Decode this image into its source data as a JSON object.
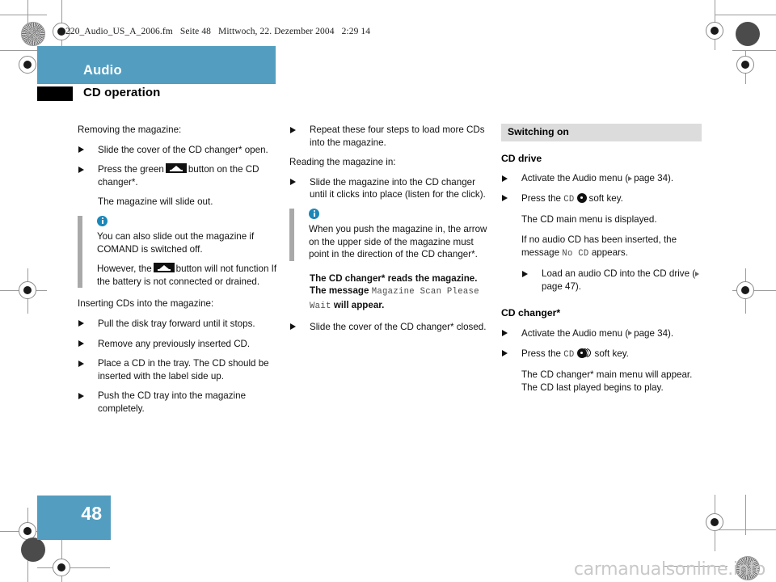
{
  "page": {
    "file_line": [
      "220_Audio_US_A_2006.fm",
      "Seite 48",
      "Mittwoch, 22. Dezember 2004",
      "2:29 14"
    ],
    "chapter_title": "Audio",
    "section_title": "CD operation",
    "page_number": "48",
    "watermark": "carmanualsonline.info",
    "brand_color": "#539ec0",
    "grey_head_color": "#dcdcdc",
    "info_icon_color": "#1a87b8"
  },
  "column1": {
    "intro": "Removing the magazine:",
    "b1": "Slide the cover of the CD changer* open.",
    "b2_pre": "Press the green",
    "b2_post": "button on the CD changer*.",
    "b2_result": "The magazine will slide out.",
    "note1_p1": "You can also slide out the magazine if COMAND is switched off.",
    "note1_p2_pre": "However, the",
    "note1_p2_post": "button will not function If the battery is not connected or drained.",
    "intro2": "Inserting CDs into the magazine:",
    "b3": "Pull the disk tray forward until it stops.",
    "b4": "Remove any previously inserted CD.",
    "b5": "Place a CD in the tray. The CD should be inserted with the label side up.",
    "b6": "Push the CD tray into the magazine completely."
  },
  "column2": {
    "b1": "Repeat these four steps to load more CDs into the magazine.",
    "intro": "Reading the magazine in:",
    "b2": "Slide the magazine into the CD changer until it clicks into place (listen for the click).",
    "note_p1": "When you push the magazine in, the arrow on the upper side of the magazine must point in the direction of the CD changer*.",
    "result_bold_1": "The CD changer* reads the magazine.",
    "result_bold_2": "The message",
    "result_mono": "Magazine Scan Please Wait",
    "result_bold_3": "will appear.",
    "b3": "Slide the cover of the CD changer* closed."
  },
  "column3": {
    "section_head": "Switching on",
    "cd_drive": {
      "head": "CD drive",
      "b1_pre": "Activate the Audio menu (",
      "b1_ref": "page 34",
      "b1_post": ").",
      "b2_pre": "Press the",
      "b2_mono": "CD",
      "b2_post": "soft key.",
      "r1": "The CD main menu is displayed.",
      "r2_pre": "If no audio CD has been inserted, the message",
      "r2_mono": "No CD",
      "r2_post": "appears.",
      "b3_pre": "Load an audio CD into the CD drive (",
      "b3_ref": "page 47",
      "b3_post": ")."
    },
    "cd_changer": {
      "head": "CD changer*",
      "b1_pre": "Activate the Audio menu (",
      "b1_ref": "page 34",
      "b1_post": ").",
      "b2_pre": "Press the",
      "b2_mono": "CD",
      "b2_post": "soft key.",
      "r1": "The CD changer* main menu will appear.",
      "r2": "The CD last played begins to play."
    }
  }
}
